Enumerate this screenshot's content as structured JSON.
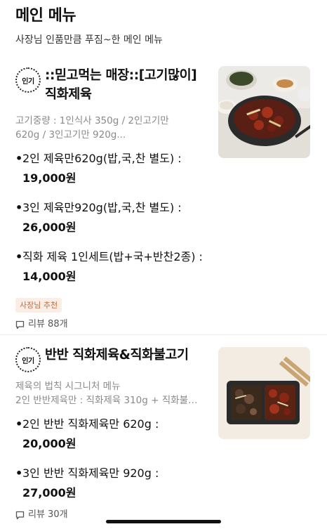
{
  "header": {
    "title": "메인 메뉴",
    "subtitle": "사장님 인품만큼 푸짐~한 메인 메뉴"
  },
  "items": [
    {
      "badge": "인기",
      "name": "::믿고먹는 매장::[고기많이] 직화제육",
      "desc_lines": [
        "고기중량 : 1인식사 350g / 2인고기만",
        "620g / 3인고기만 920g..."
      ],
      "options": [
        {
          "label": "2인 제육만620g(밥,국,찬 별도) :",
          "price": "19,000원"
        },
        {
          "label": "3인 제육만920g(밥,국,찬 별도) :",
          "price": "26,000원"
        },
        {
          "label": "직화 제육 1인세트(밥+국+반찬2종) :",
          "price": "14,000원"
        }
      ],
      "tag": "사장님 추천",
      "review": "리뷰 88개",
      "image_icon": "spicy-pork-skillet-photo"
    },
    {
      "badge": "인기",
      "name": "반반 직화제육&직화불고기",
      "desc_lines": [
        "제육의 법칙 시그니처 메뉴",
        "2인 반반제육만 : 직화제육 310g + 직화불고기..."
      ],
      "options": [
        {
          "label": "2인 반반 직화제육만 620g :",
          "price": "20,000원"
        },
        {
          "label": "3인 반반 직화제육만 920g :",
          "price": "27,000원"
        }
      ],
      "review": "리뷰 30개",
      "image_icon": "half-half-pork-tray-photo"
    }
  ],
  "colors": {
    "tag_bg": "#fbeee6",
    "tag_text": "#c06a3a",
    "muted_text": "#8a8a8a"
  }
}
